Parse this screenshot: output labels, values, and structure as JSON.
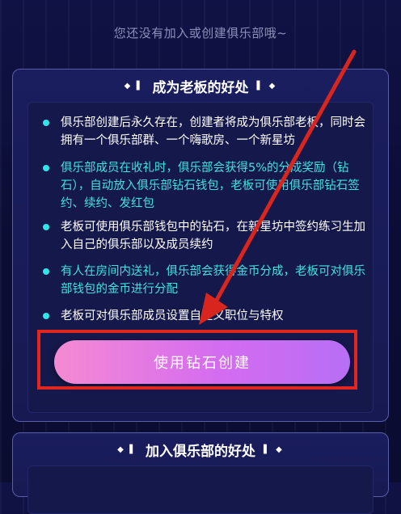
{
  "empty_state": {
    "text": "您还没有加入或创建俱乐部哦~"
  },
  "boss_card": {
    "title": "成为老板的好处",
    "deco_left": "◆ ▌",
    "deco_right": "▌ ◆",
    "items": [
      {
        "text": "俱乐部创建后永久存在，创建者将成为俱乐部老板，同时会拥有一个俱乐部群、一个嗨歌房、一个新星坊",
        "color": "white"
      },
      {
        "text": "俱乐部成员在收礼时，俱乐部会获得5%的分成奖励（钻石），自动放入俱乐部钻石钱包，老板可使用俱乐部钻石签约、续约、发红包",
        "color": "cyan"
      },
      {
        "text": "老板可使用俱乐部钱包中的钻石，在新星坊中签约练习生加入自己的俱乐部以及成员续约",
        "color": "white"
      },
      {
        "text": " 有人在房间内送礼，俱乐部会获得金币分成，老板可对俱乐部钱包的金币进行分配",
        "color": "cyan"
      },
      {
        "text": "老板可对俱乐部成员设置自定义职位与特权",
        "color": "white"
      }
    ],
    "button_label": "使用钻石创建"
  },
  "join_card": {
    "title": "加入俱乐部的好处",
    "deco_left": "◆ ▌",
    "deco_right": "▌ ◆"
  },
  "colors": {
    "accent_cyan": "#3fe3e0",
    "button_pink": "#f58ad2",
    "button_purple": "#b76ef5",
    "annotation_red": "#e0261f"
  }
}
